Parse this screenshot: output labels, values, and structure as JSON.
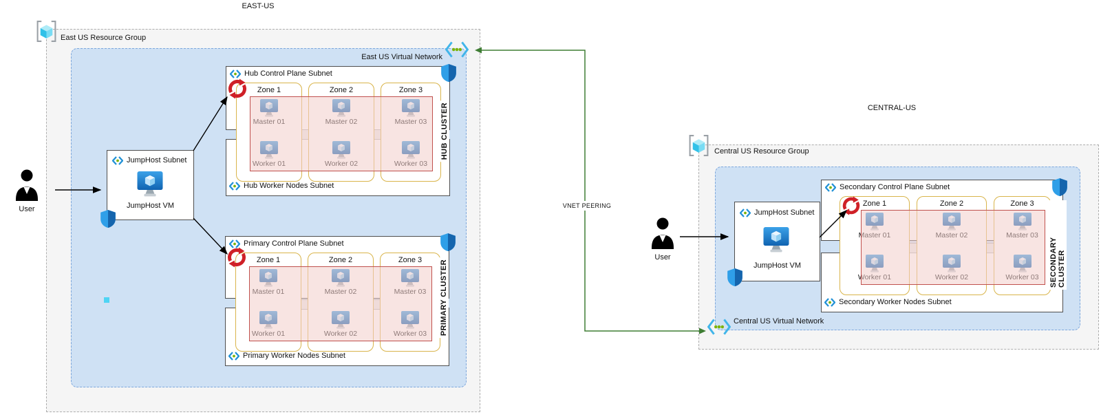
{
  "diagram": {
    "east": {
      "region_title": "EAST-US",
      "resource_group_label": "East US Resource Group",
      "vnet_label": "East US Virtual Network",
      "jumphost_subnet_label": "JumpHost Subnet",
      "jumphost_vm_label": "JumpHost VM",
      "user_label": "User"
    },
    "central": {
      "region_title": "CENTRAL-US",
      "resource_group_label": "Central US Resource Group",
      "vnet_label": "Central US Virtual Network",
      "jumphost_subnet_label": "JumpHost Subnet",
      "jumphost_vm_label": "JumpHost VM",
      "user_label": "User"
    },
    "peering_label": "VNET PEERING",
    "clusters": {
      "hub": {
        "name": "HUB CLUSTER",
        "control_subnet": "Hub Control Plane Subnet",
        "worker_subnet": "Hub Worker Nodes Subnet",
        "zones": [
          {
            "label": "Zone 1",
            "master": "Master 01",
            "worker": "Worker 01"
          },
          {
            "label": "Zone 2",
            "master": "Master 02",
            "worker": "Worker 02"
          },
          {
            "label": "Zone 3",
            "master": "Master 03",
            "worker": "Worker 03"
          }
        ]
      },
      "primary": {
        "name": "PRIMARY CLUSTER",
        "control_subnet": "Primary Control Plane Subnet",
        "worker_subnet": "Primary Worker Nodes Subnet",
        "zones": [
          {
            "label": "Zone 1",
            "master": "Master 01",
            "worker": "Worker 01"
          },
          {
            "label": "Zone 2",
            "master": "Master 02",
            "worker": "Worker 02"
          },
          {
            "label": "Zone 3",
            "master": "Master 03",
            "worker": "Worker 03"
          }
        ]
      },
      "secondary": {
        "name": "SECONDARY CLUSTER",
        "control_subnet": "Secondary Control Plane Subnet",
        "worker_subnet": "Secondary Worker Nodes Subnet",
        "zones": [
          {
            "label": "Zone 1",
            "master": "Master 01",
            "worker": "Worker 01"
          },
          {
            "label": "Zone 2",
            "master": "Master 02",
            "worker": "Worker 02"
          },
          {
            "label": "Zone 3",
            "master": "Master 03",
            "worker": "Worker 03"
          }
        ]
      }
    },
    "colors": {
      "vnet_fill": "#cfe1f4",
      "vnet_border": "#7da7dc",
      "resource_group_fill": "#f5f5f5",
      "resource_group_border": "#adadad",
      "zone_border": "#d9b44a",
      "pink_fill": "#f3cdcb",
      "pink_border": "#c0504d",
      "peering_green": "#3e7d33",
      "azure_blue": "#1b7fd4",
      "cube_cyan": "#55d0f2",
      "shield_blue": "#2f9fe8",
      "subnet_dot_green": "#7cb305",
      "cluster_red": "#cf2027",
      "arrow_black": "#000000"
    }
  }
}
